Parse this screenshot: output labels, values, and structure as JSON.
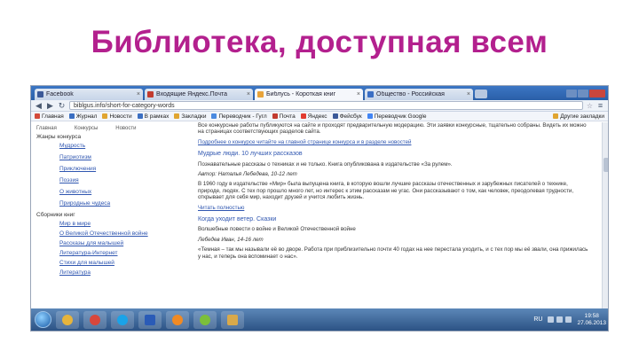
{
  "slide": {
    "title": "Библиотека, доступная всем"
  },
  "browser": {
    "tabs": [
      {
        "label": "Facebook",
        "favicon_color": "#3b5998",
        "active": false
      },
      {
        "label": "Входящие Яндекс.Почта",
        "favicon_color": "#c23b2f",
        "active": false
      },
      {
        "label": "Библусь - Короткая книг",
        "favicon_color": "#e8a33a",
        "active": true
      },
      {
        "label": "Общество - Российская",
        "favicon_color": "#3a6ec4",
        "active": false
      }
    ],
    "address": "biblgus.info/short-for-category-words",
    "bookmarks": [
      {
        "label": "Главная"
      },
      {
        "label": "Журнал"
      },
      {
        "label": "Новости"
      },
      {
        "label": "В рамках"
      },
      {
        "label": "Закладки"
      },
      {
        "label": "Переводчик - Гугл"
      },
      {
        "label": "Почта"
      },
      {
        "label": "Яндекс"
      },
      {
        "label": "Фейсбук"
      },
      {
        "label": "Переводчик Google"
      }
    ],
    "bookmarks_other": "Другие закладки"
  },
  "page": {
    "top_links": [
      "Главная",
      "Конкурсы",
      "Новости"
    ],
    "sidebar_head1": "Жанры конкурса",
    "sidebar_group1": [
      "Мудрость",
      "Патриотизм",
      "Приключения"
    ],
    "sidebar_group1b": [
      "Поэзия",
      "О животных",
      "Природные чудеса"
    ],
    "sidebar_head2": "Сборники книг",
    "sidebar_group2": [
      "Мир в мире",
      "О Великой Отечественной войне",
      "Рассказы для малышей",
      "Литература-Интернет",
      "Стихи для малышей",
      "Литература"
    ],
    "content": {
      "p1": "Все конкурсные работы публикуются на сайте и проходят предварительную модерацию. Эти заявки конкурсные, тщательно собраны. Видеть их можно на страницах соответствующих разделов сайта.",
      "p1_link": "Подробнее о конкурсе читайте на главной странице конкурса и в разделе новостей",
      "h1": "Мудрые люди. 10 лучших рассказов",
      "p2": "Познавательные рассказы о техниках и не только. Книга опубликована в издательстве «За рулем».",
      "p2_meta": "Автор: Наталья Лебедева, 10-12 лет",
      "p3": "В 1960 году в издательстве «Мир» была выпущена книга, в которую вошли лучшие рассказы отечественных и зарубежных писателей о технике, природе, людях. С тех пор прошло много лет, но интерес к этим рассказам не угас. Они рассказывают о том, как человек, преодолевая трудности, открывает для себя мир, находит друзей и учится любить жизнь.",
      "p3_link": "Читать полностью",
      "h2": "Когда уходит ветер. Сказки",
      "p4": "Волшебные повести о войне и Великой Отечественной войне",
      "p4_meta": "Лебедев Иван, 14-16 лет",
      "p5": "«Темная – так мы называли её во дворе. Работа при приблизительно почти 40 годах на нее перестала уходить, и с тех пор мы её звали, она прижилась у нас, и теперь она вспоминает о нас»."
    }
  },
  "taskbar": {
    "lang": "RU",
    "time": "19:58",
    "date": "27.06.2013",
    "apps": [
      {
        "icon": "explorer-icon",
        "color": "#e6b43c"
      },
      {
        "icon": "chrome-icon",
        "color": "#d8473c"
      },
      {
        "icon": "skype-icon",
        "color": "#1aa3e8"
      },
      {
        "icon": "word-icon",
        "color": "#2a5bb7"
      },
      {
        "icon": "media-player-icon",
        "color": "#f08a24"
      },
      {
        "icon": "paint-icon",
        "color": "#7cbf3a"
      },
      {
        "icon": "folder-icon",
        "color": "#d9a94a"
      }
    ]
  }
}
